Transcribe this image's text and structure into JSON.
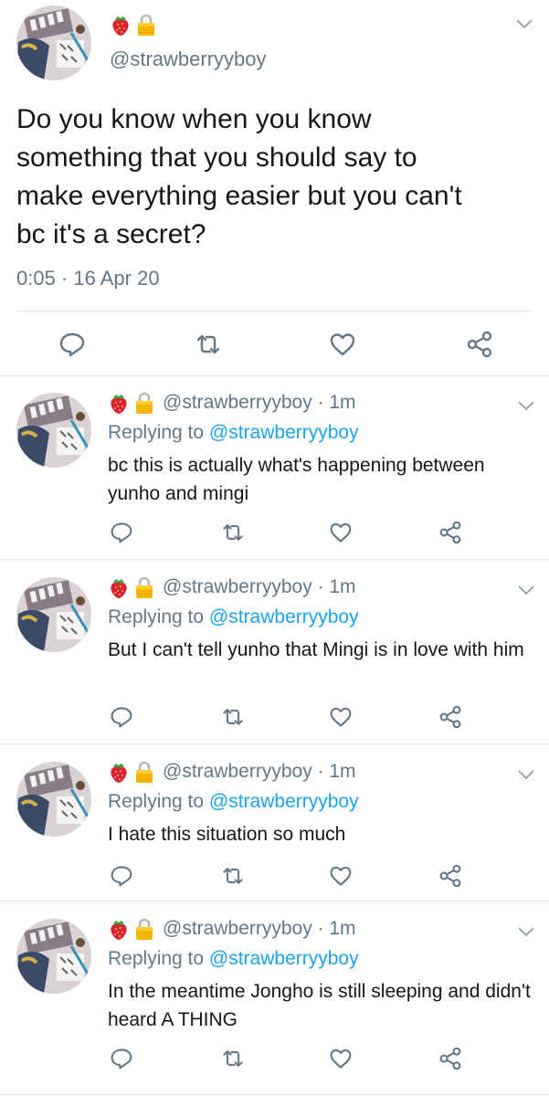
{
  "main_tweet": {
    "handle": "@strawberryyboy",
    "text": "Do you know when you know\nsomething that you should say to\nmake everything easier but you can't\nbc it's a secret?",
    "timestamp": "0:05 · 16 Apr 20",
    "emoji": [
      "strawberry-icon",
      "lock-icon"
    ]
  },
  "replies": [
    {
      "handle": "@strawberryyboy",
      "time": "1m",
      "replying_prefix": "Replying to ",
      "replying_to": "@strawberryyboy",
      "text": "bc this is actually what's happening between yunho and mingi"
    },
    {
      "handle": "@strawberryyboy",
      "time": "1m",
      "replying_prefix": "Replying to ",
      "replying_to": "@strawberryyboy",
      "text": "But I can't tell yunho that Mingi is in love with him"
    },
    {
      "handle": "@strawberryyboy",
      "time": "1m",
      "replying_prefix": "Replying to ",
      "replying_to": "@strawberryyboy",
      "text": "I hate this situation so much"
    },
    {
      "handle": "@strawberryyboy",
      "time": "1m",
      "replying_prefix": "Replying to ",
      "replying_to": "@strawberryyboy",
      "text": "In the meantime Jongho is still sleeping and didn't heard A THING"
    }
  ],
  "separator": " · ",
  "colors": {
    "text": "#14171a",
    "secondary": "#657786",
    "link": "#1da1f2",
    "divider": "#dde3e8"
  }
}
